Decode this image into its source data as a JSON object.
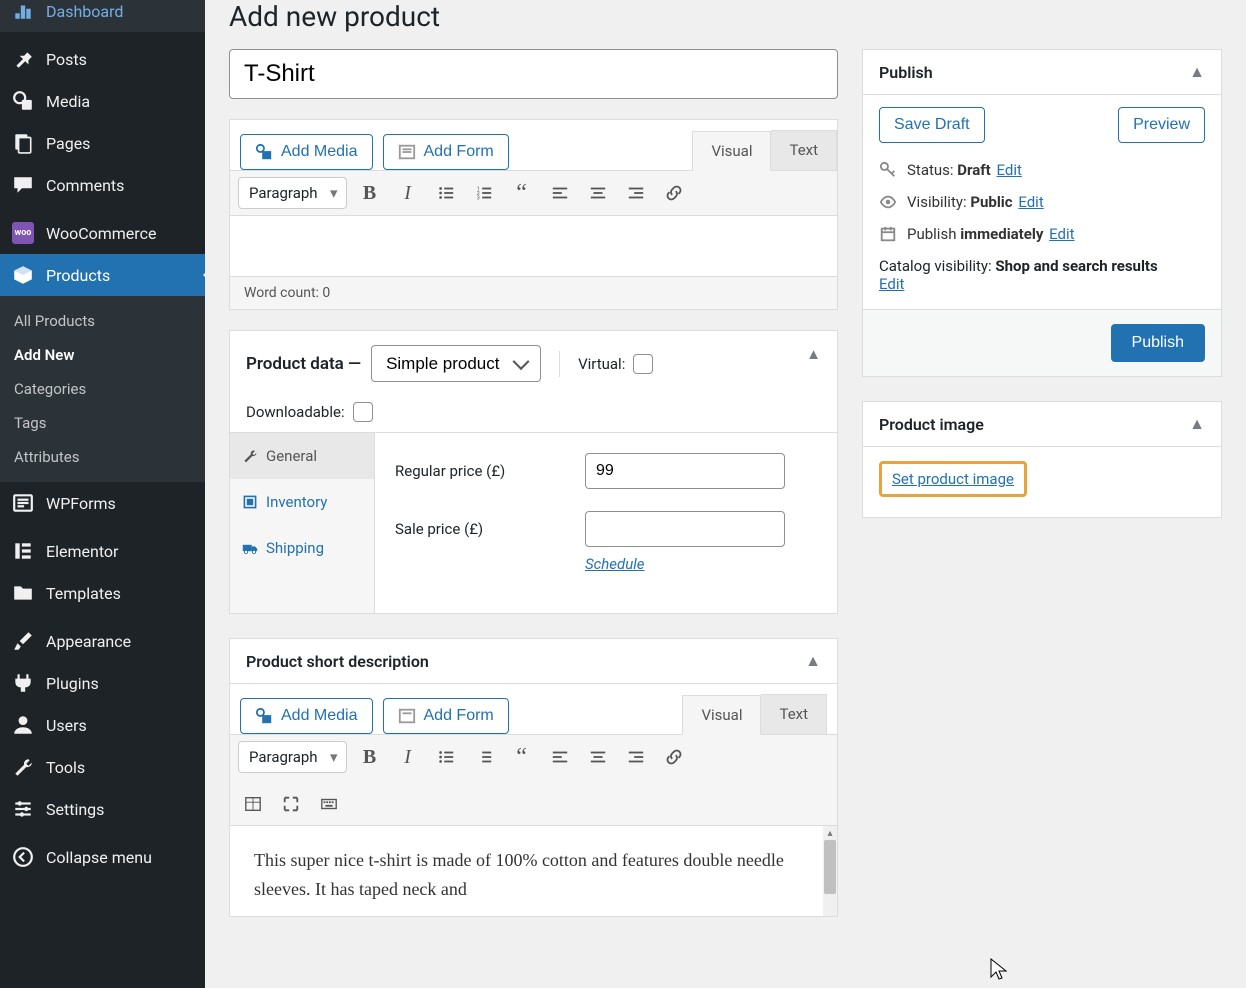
{
  "sidebar": {
    "items": [
      {
        "label": "Dashboard"
      },
      {
        "label": "Posts"
      },
      {
        "label": "Media"
      },
      {
        "label": "Pages"
      },
      {
        "label": "Comments"
      },
      {
        "label": "WooCommerce"
      },
      {
        "label": "Products",
        "active": true,
        "submenu": [
          {
            "label": "All Products"
          },
          {
            "label": "Add New",
            "current": true
          },
          {
            "label": "Categories"
          },
          {
            "label": "Tags"
          },
          {
            "label": "Attributes"
          }
        ]
      },
      {
        "label": "WPForms"
      },
      {
        "label": "Elementor"
      },
      {
        "label": "Templates"
      },
      {
        "label": "Appearance"
      },
      {
        "label": "Plugins"
      },
      {
        "label": "Users"
      },
      {
        "label": "Tools"
      },
      {
        "label": "Settings"
      },
      {
        "label": "Collapse menu"
      }
    ]
  },
  "page": {
    "title": "Add new product"
  },
  "product": {
    "title": "T-Shirt"
  },
  "editor": {
    "add_media": "Add Media",
    "add_form": "Add Form",
    "tab_visual": "Visual",
    "tab_text": "Text",
    "format": "Paragraph",
    "word_count": "Word count: 0"
  },
  "product_data": {
    "title": "Product data —",
    "type": "Simple product",
    "virtual_label": "Virtual:",
    "downloadable_label": "Downloadable:",
    "tabs": {
      "general": "General",
      "inventory": "Inventory",
      "shipping": "Shipping"
    },
    "regular_price_label": "Regular price (£)",
    "regular_price": "99",
    "sale_price_label": "Sale price (£)",
    "sale_price": "",
    "schedule": "Schedule"
  },
  "short_desc": {
    "title": "Product short description",
    "content": "This super nice t-shirt is made of 100% cotton and features double needle sleeves. It has taped neck and"
  },
  "publish": {
    "title": "Publish",
    "save_draft": "Save Draft",
    "preview": "Preview",
    "status_label": "Status:",
    "status": "Draft",
    "visibility_label": "Visibility:",
    "visibility": "Public",
    "publish_label": "Publish",
    "publish_val": "immediately",
    "catalog_label": "Catalog visibility:",
    "catalog_val": "Shop and search results",
    "edit": "Edit",
    "publish_btn": "Publish"
  },
  "product_image": {
    "title": "Product image",
    "link": "Set product image"
  }
}
